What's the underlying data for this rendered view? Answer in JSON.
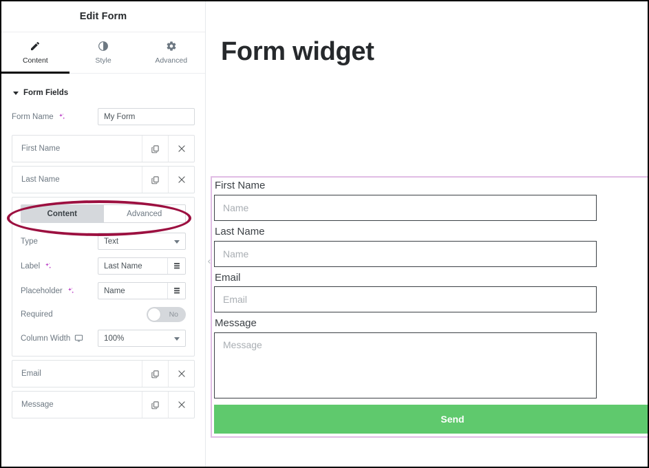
{
  "panel": {
    "title": "Edit Form",
    "tabs": [
      {
        "label": "Content",
        "icon": "pencil-icon",
        "active": true
      },
      {
        "label": "Style",
        "icon": "contrast-icon",
        "active": false
      },
      {
        "label": "Advanced",
        "icon": "gear-icon",
        "active": false
      }
    ],
    "section": {
      "title": "Form Fields"
    },
    "form_name": {
      "label": "Form Name",
      "value": "My Form",
      "ai_icon": "sparkle-icon"
    },
    "fields": [
      {
        "name": "First Name",
        "duplicate_icon": "copy-icon",
        "remove_icon": "close-icon"
      },
      {
        "name": "Last Name",
        "duplicate_icon": "copy-icon",
        "remove_icon": "close-icon"
      },
      {
        "name": "Email",
        "duplicate_icon": "copy-icon",
        "remove_icon": "close-icon"
      },
      {
        "name": "Message",
        "duplicate_icon": "copy-icon",
        "remove_icon": "close-icon"
      }
    ],
    "field_settings": {
      "tabs": [
        {
          "label": "Content",
          "active": true
        },
        {
          "label": "Advanced",
          "active": false
        }
      ],
      "type": {
        "label": "Type",
        "value": "Text"
      },
      "field_label": {
        "label": "Label",
        "value": "Last Name",
        "ai_icon": "sparkle-icon",
        "tag_icon": "dynamic-tags-icon"
      },
      "placeholder": {
        "label": "Placeholder",
        "value": "Name",
        "ai_icon": "sparkle-icon",
        "tag_icon": "dynamic-tags-icon"
      },
      "required": {
        "label": "Required",
        "value": "No",
        "state": "off"
      },
      "column_width": {
        "label": "Column Width",
        "value": "100%",
        "device_icon": "desktop-icon"
      }
    }
  },
  "preview": {
    "collapse_icon": "chevron-left-icon",
    "heading": "Form widget",
    "form": [
      {
        "label": "First Name",
        "placeholder": "Name",
        "control": "input"
      },
      {
        "label": "Last Name",
        "placeholder": "Name",
        "control": "input"
      },
      {
        "label": "Email",
        "placeholder": "Email",
        "control": "input"
      },
      {
        "label": "Message",
        "placeholder": "Message",
        "control": "textarea"
      }
    ],
    "submit": {
      "label": "Send"
    }
  },
  "annotation": {
    "shape": "ellipse",
    "target": "Last Name field row",
    "color": "#9c1040"
  },
  "colors": {
    "accent_green": "#5fc96d",
    "highlight_purple": "#e0bce4",
    "ai_purple": "#b838c4",
    "annotation_red": "#9c1040"
  }
}
